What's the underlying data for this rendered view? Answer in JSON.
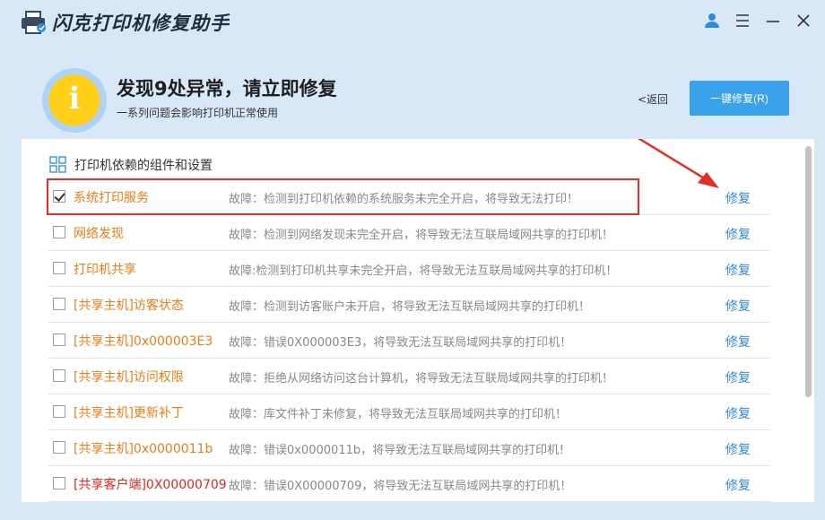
{
  "app": {
    "title": "闪克打印机修复助手"
  },
  "window_controls": [
    "user-icon",
    "menu-icon",
    "minimize-icon",
    "close-icon"
  ],
  "header": {
    "icon_glyph": "i",
    "title": "发现9处异常，请立即修复",
    "subtitle": "一系列问题会影响打印机正常使用",
    "back_label": "<返回",
    "fix_all_label": "一键修复(R)"
  },
  "section": {
    "title": "打印机依赖的组件和设置"
  },
  "colors": {
    "accent": "#3aa2ea",
    "warning": "#f07c17",
    "danger": "#e8231b",
    "highlight": "#e52d27"
  },
  "items": [
    {
      "name": "系统打印服务",
      "desc": "故障：检测到打印机依赖的系统服务未完全开启，将导致无法打印！",
      "fix": "修复",
      "checked": true
    },
    {
      "name": "网络发现",
      "desc": "故障：检测到网络发现未完全开启，将导致无法互联局域网共享的打印机！",
      "fix": "修复",
      "checked": false
    },
    {
      "name": "打印机共享",
      "desc": "故障:检测到打印机共享未完全开启，将导致无法互联局域网共享的打印机！",
      "fix": "修复",
      "checked": false
    },
    {
      "name": "[共享主机]访客状态",
      "desc": "故障：检测到访客账户未开启，将导致无法互联局域网共享的打印机！",
      "fix": "修复",
      "checked": false
    },
    {
      "name": "[共享主机]0x000003E3",
      "desc": "故障：错误0X000003E3，将导致无法互联局域网共享的打印机！",
      "fix": "修复",
      "checked": false
    },
    {
      "name": "[共享主机]访问权限",
      "desc": "故障：拒绝从网络访问这台计算机，将导致无法互联局域网共享的打印机！",
      "fix": "修复",
      "checked": false
    },
    {
      "name": "[共享主机]更新补丁",
      "desc": "故障：库文件补丁未修复，将导致无法互联局域网共享的打印机！",
      "fix": "修复",
      "checked": false
    },
    {
      "name": "[共享主机]0x0000011b",
      "desc": "故障：错误0x0000011b，将导致无法互联局域网共享的打印机！",
      "fix": "修复",
      "checked": false
    },
    {
      "name": "[共享客户端]0X00000709",
      "desc": "故障：错误0X00000709，将导致无法互联局域网共享的打印机！",
      "fix": "修复",
      "checked": false,
      "red": true
    }
  ]
}
